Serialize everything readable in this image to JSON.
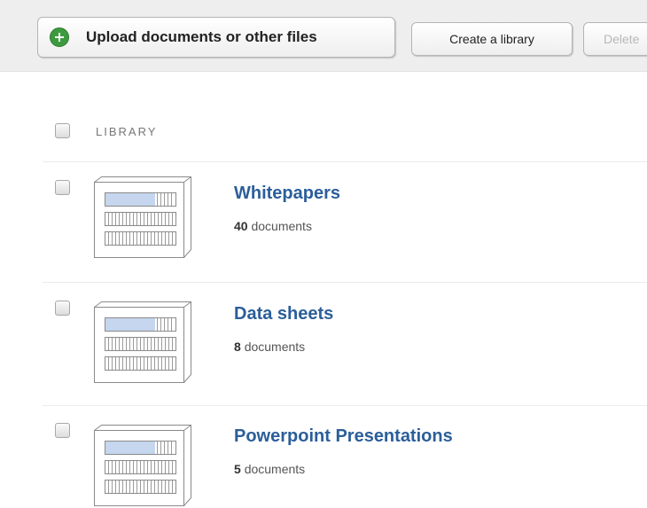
{
  "toolbar": {
    "upload_label": "Upload documents or other files",
    "create_label": "Create a library",
    "delete_label": "Delete"
  },
  "list_header": {
    "label": "LIBRARY"
  },
  "libraries": [
    {
      "title": "Whitepapers",
      "count": "40",
      "unit": "documents"
    },
    {
      "title": "Data sheets",
      "count": "8",
      "unit": "documents"
    },
    {
      "title": "Powerpoint Presentations",
      "count": "5",
      "unit": "documents"
    }
  ],
  "colors": {
    "link": "#2b5e9a",
    "add_icon": "#3d9b3f",
    "toolbar_bg": "#eeeeee"
  },
  "icons": {
    "upload": "plus-circle-icon",
    "library": "bookshelf-icon"
  }
}
